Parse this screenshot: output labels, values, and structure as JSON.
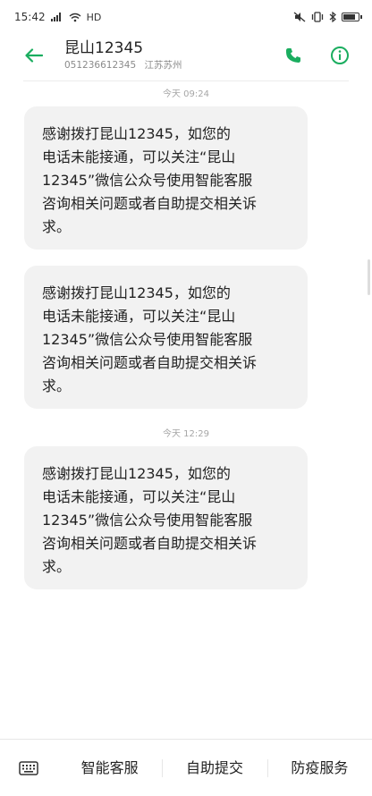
{
  "status_bar": {
    "time": "15:42",
    "network": "HD",
    "battery_level": 0.8
  },
  "header": {
    "title": "昆山12345",
    "number": "051236612345",
    "location": "江苏苏州"
  },
  "messages": [
    {
      "timestamp": "今天 09:24",
      "text": "感谢拨打昆山12345，如您的\n电话未能接通，可以关注“昆山\n12345”微信公众号使用智能客服\n咨询相关问题或者自助提交相关诉\n求。"
    },
    {
      "timestamp": "",
      "text": "感谢拨打昆山12345，如您的\n电话未能接通，可以关注“昆山\n12345”微信公众号使用智能客服\n咨询相关问题或者自助提交相关诉\n求。"
    },
    {
      "timestamp": "今天 12:29",
      "text": "感谢拨打昆山12345，如您的\n电话未能接通，可以关注“昆山\n12345”微信公众号使用智能客服\n咨询相关问题或者自助提交相关诉\n求。"
    }
  ],
  "menu": {
    "items": [
      "智能客服",
      "自助提交",
      "防疫服务"
    ]
  },
  "colors": {
    "accent": "#1aad5f",
    "bubble": "#f2f2f2"
  }
}
